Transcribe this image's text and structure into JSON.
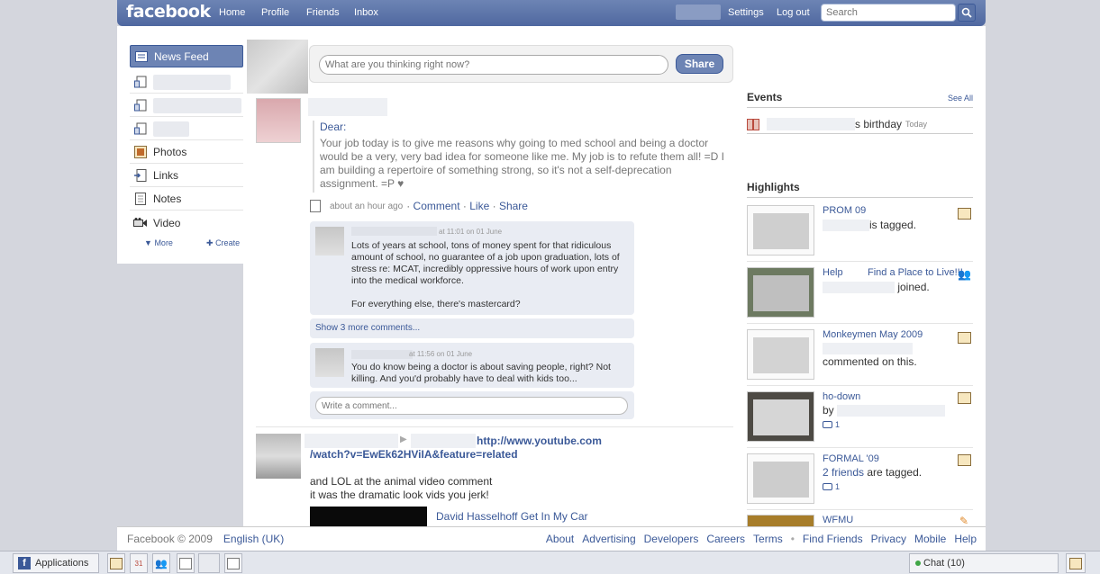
{
  "topbar": {
    "logo": "facebook",
    "nav": [
      "Home",
      "Profile",
      "Friends",
      "Inbox"
    ],
    "settings": "Settings",
    "logout": "Log out",
    "search_placeholder": "Search"
  },
  "leftnav": {
    "news_feed": "News Feed",
    "photos": "Photos",
    "links": "Links",
    "notes": "Notes",
    "video": "Video",
    "more": "More",
    "create": "Create"
  },
  "composer": {
    "placeholder": "What are you thinking right now?",
    "share": "Share"
  },
  "story1": {
    "note_title": "Dear:",
    "note_body": "Your job today is to give me reasons why going to med school and being a doctor would be a very, very bad idea for someone like me. My job is to refute them all! =D I am building a repertoire of something strong, so it's not a self-deprecation assignment. =P ♥",
    "time": "about an hour ago",
    "comment": "Comment",
    "like": "Like",
    "share": "Share",
    "sep": "·",
    "comment1_time": "at 11:01 on 01 June",
    "comment1_text_a": "Lots of years at school, tons of money spent for that ridiculous amount of school, no guarantee of a job upon graduation, lots of stress re: MCAT, incredibly oppressive hours of work upon entry into the medical workforce.",
    "comment1_text_b": "For everything else, there's mastercard?",
    "show_more": "Show 3 more comments...",
    "comment2_time": "at 11:56 on 01 June",
    "comment2_text": "You do know being a doctor is about saving people, right? Not killing. And you'd probably have to deal with kids too...",
    "write_comment": "Write a comment..."
  },
  "story2": {
    "url_a": "http://www.youtube.com",
    "url_b": "/watch?v=EwEk62HViIA&feature=related",
    "line1": "and LOL at the animal video comment",
    "line2": "it was the dramatic look vids you jerk!",
    "video_title": "David Hasselhoff Get In My Car"
  },
  "events": {
    "heading": "Events",
    "see_all": "See All",
    "birthday": "s birthday",
    "when": "Today"
  },
  "highlights": {
    "heading": "Highlights",
    "items": [
      {
        "title": "PROM 09",
        "text": "is tagged."
      },
      {
        "title": "Help",
        "title2": "Find a Place to Live!!!",
        "text": "joined."
      },
      {
        "title": "Monkeymen May 2009",
        "text": "commented on this."
      },
      {
        "title": "ho-down",
        "text": "by",
        "comments": "1"
      },
      {
        "title": "FORMAL '09",
        "text_link": "2 friends",
        "text": "are tagged.",
        "comments": "1"
      },
      {
        "title": "WFMU"
      }
    ]
  },
  "footer": {
    "copyright": "Facebook © 2009",
    "language": "English (UK)",
    "links": [
      "About",
      "Advertising",
      "Developers",
      "Careers",
      "Terms",
      "•",
      "Find Friends",
      "Privacy",
      "Mobile",
      "Help"
    ]
  },
  "chatbar": {
    "applications": "Applications",
    "calendar_day": "31",
    "chat": "Chat (10)"
  }
}
